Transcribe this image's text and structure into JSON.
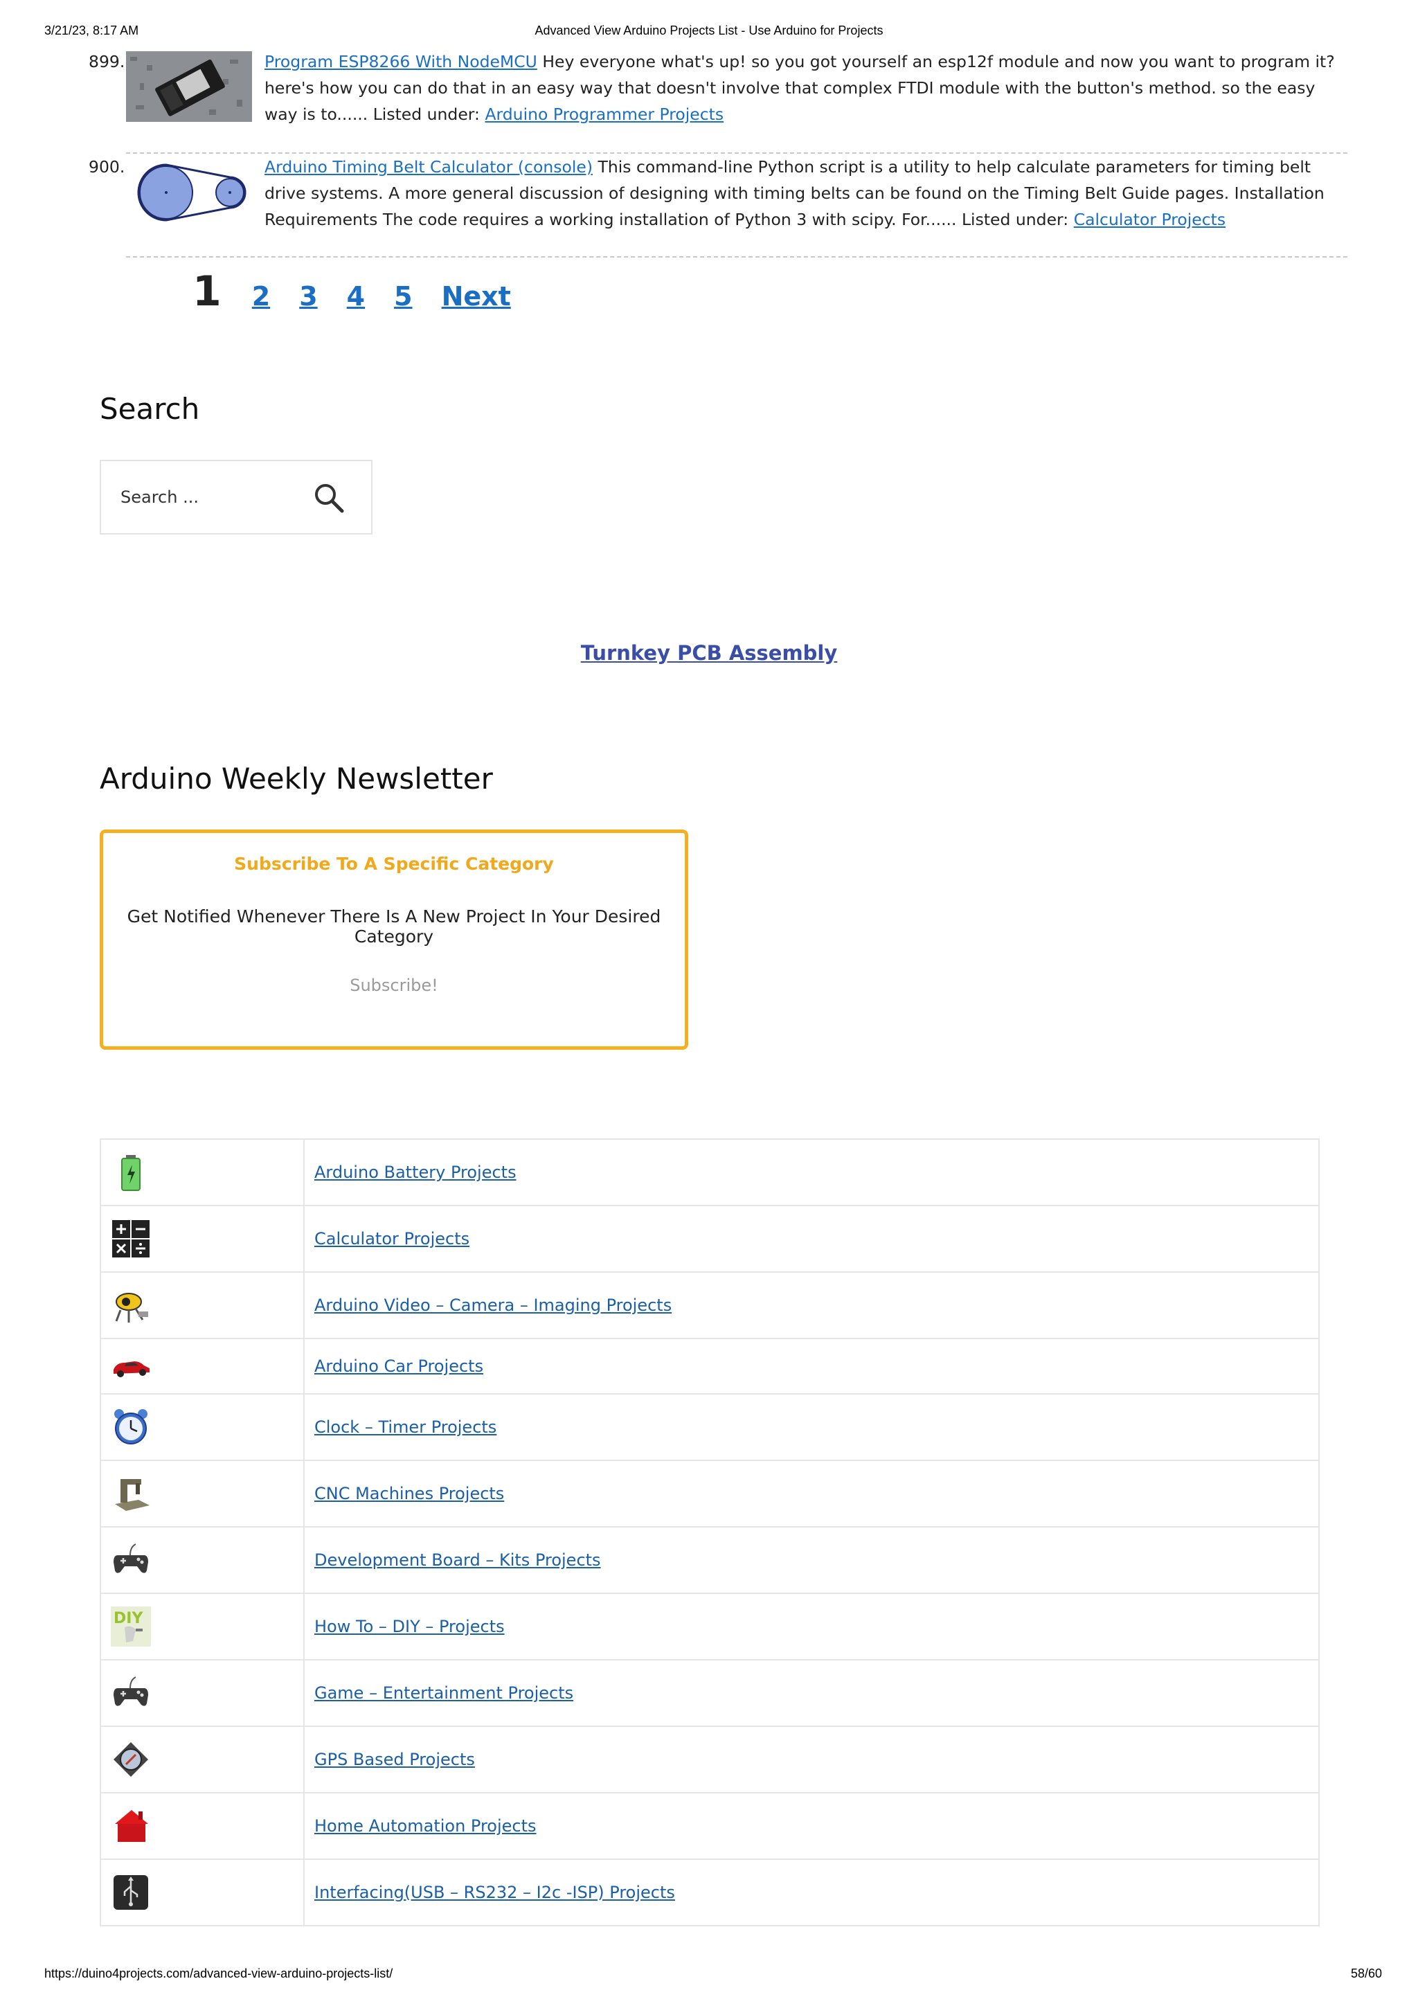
{
  "print_header": {
    "datetime": "3/21/23, 8:17 AM",
    "title": "Advanced View Arduino Projects List - Use Arduino for Projects"
  },
  "print_footer": {
    "url": "https://duino4projects.com/advanced-view-arduino-projects-list/",
    "page": "58/60"
  },
  "projects": [
    {
      "num": "899.",
      "title": "Program ESP8266 With NodeMCU",
      "desc": " Hey everyone what's up! so you got yourself an esp12f module and now you want to program it? here's how you can do that in an easy way that doesn't involve that complex FTDI module with the button's method. so the easy way is to...... Listed under: ",
      "category": "Arduino Programmer Projects"
    },
    {
      "num": "900.",
      "title": "Arduino Timing Belt Calculator (console)",
      "desc": " This command-line Python script is a utility to help calculate parameters for timing belt drive systems. A more general discussion of designing with timing belts can be found on the Timing Belt Guide pages. Installation Requirements The code requires a working installation of Python 3 with scipy. For...... Listed under: ",
      "category": "Calculator Projects"
    }
  ],
  "pagination": {
    "current": "1",
    "pages": [
      "2",
      "3",
      "4",
      "5"
    ],
    "next": "Next"
  },
  "search": {
    "heading": "Search",
    "placeholder": "Search ...",
    "icon": "search-icon"
  },
  "turnkey_link": "Turnkey PCB Assembly",
  "newsletter": {
    "heading": "Arduino Weekly Newsletter",
    "title": "Subscribe To A Specific Category",
    "description": "Get Notified Whenever There Is A New Project In Your Desired Category",
    "button": "Subscribe!",
    "border_color": "#f5b021"
  },
  "categories": [
    {
      "label": "Arduino Battery Projects",
      "icon": "battery-icon"
    },
    {
      "label": "Calculator Projects",
      "icon": "calculator-icon"
    },
    {
      "label": "Arduino Video – Camera – Imaging Projects",
      "icon": "camera-icon"
    },
    {
      "label": "Arduino Car Projects",
      "icon": "car-icon"
    },
    {
      "label": "Clock – Timer Projects",
      "icon": "alarm-clock-icon"
    },
    {
      "label": "CNC Machines Projects",
      "icon": "cnc-machine-icon"
    },
    {
      "label": "Development Board – Kits Projects",
      "icon": "gamepad-icon"
    },
    {
      "label": "How To – DIY – Projects",
      "icon": "diy-icon"
    },
    {
      "label": "Game – Entertainment Projects",
      "icon": "gamepad-icon"
    },
    {
      "label": "GPS Based Projects",
      "icon": "gps-icon"
    },
    {
      "label": "Home Automation Projects",
      "icon": "house-icon"
    },
    {
      "label": "Interfacing(USB – RS232 – I2c -ISP) Projects",
      "icon": "usb-icon"
    }
  ]
}
